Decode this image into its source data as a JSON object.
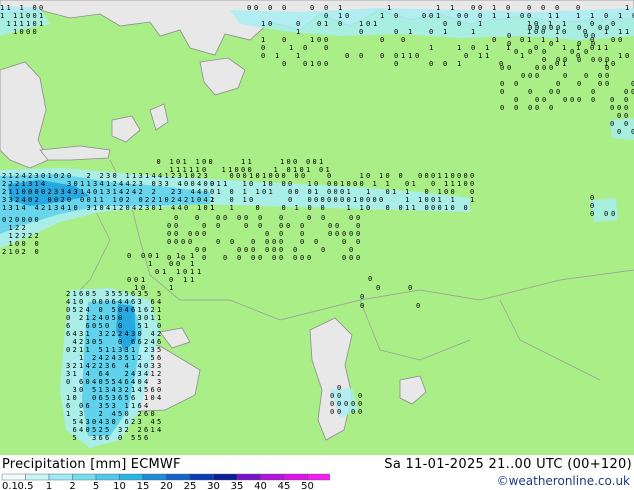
{
  "map": {
    "colors": {
      "land": "#aaee88",
      "sea": "#e8e8e8",
      "coast": "#8c8c8c",
      "border": "#9a9a9a",
      "precip_light": "#a8eef2",
      "precip_mid": "#60d2ec",
      "precip_strong": "#28a8e0",
      "digits": "#000000"
    }
  },
  "footer": {
    "title": "Precipitation [mm]  ECMWF",
    "datetime": "Sa 11-01-2025 21..00 UTC (00+120)",
    "credit": "©weatheronline.co.uk",
    "scale": {
      "labels": [
        "0.1",
        "0.5",
        "1",
        "2",
        "5",
        "10",
        "15",
        "20",
        "25",
        "30",
        "35",
        "40",
        "45",
        "50"
      ],
      "colors": [
        "#f0fcfc",
        "#c8f4f8",
        "#a0e8f4",
        "#78dcf0",
        "#50c8ec",
        "#28b4e4",
        "#1e8cd8",
        "#1464c8",
        "#0a3cb4",
        "#0a1e96",
        "#7814c8",
        "#b414dc",
        "#dc14e6",
        "#f01ef0"
      ]
    }
  }
}
